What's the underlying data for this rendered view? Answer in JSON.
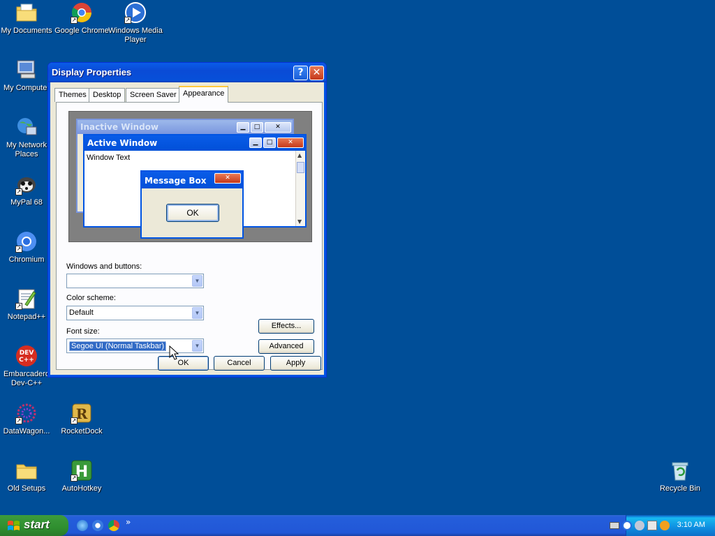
{
  "desktop": {
    "icons": [
      {
        "label": "My Documents",
        "icon": "folder-documents-icon"
      },
      {
        "label": "Google Chrome",
        "icon": "chrome-icon"
      },
      {
        "label": "Windows Media Player",
        "icon": "media-player-icon"
      },
      {
        "label": "My Computer",
        "icon": "computer-icon"
      },
      {
        "label": "My Network Places",
        "icon": "network-icon"
      },
      {
        "label": "MyPal 68",
        "icon": "raccoon-icon"
      },
      {
        "label": "Chromium",
        "icon": "chromium-icon"
      },
      {
        "label": "Notepad++",
        "icon": "notepadpp-icon"
      },
      {
        "label": "Embarcadero Dev-C++",
        "icon": "devcpp-icon"
      },
      {
        "label": "DataWagon...",
        "icon": "datawagon-icon"
      },
      {
        "label": "RocketDock",
        "icon": "rocketdock-icon"
      },
      {
        "label": "Old Setups",
        "icon": "folder-icon"
      },
      {
        "label": "AutoHotkey",
        "icon": "autohotkey-icon"
      },
      {
        "label": "Recycle Bin",
        "icon": "recycle-bin-icon"
      }
    ],
    "devcpp_badge": "DEV\nC++",
    "autohotkey_letter": "H",
    "rocketdock_letter": "R"
  },
  "dialog": {
    "title": "Display Properties",
    "help_glyph": "?",
    "close_glyph": "✕",
    "tabs": [
      {
        "label": "Themes"
      },
      {
        "label": "Desktop"
      },
      {
        "label": "Screen Saver"
      },
      {
        "label": "Appearance",
        "active": true
      }
    ],
    "preview": {
      "inactive_title": "Inactive Window",
      "active_title": "Active Window",
      "window_text": "Window Text",
      "message_title": "Message Box",
      "ok_label": "OK"
    },
    "windows_and_buttons": {
      "label": "Windows and buttons:",
      "value": ""
    },
    "color_scheme": {
      "label": "Color scheme:",
      "value": "Default"
    },
    "font_size": {
      "label": "Font size:",
      "value": "Segoe UI (Normal Taskbar)"
    },
    "effects_label": "Effects...",
    "advanced_label": "Advanced",
    "ok_label": "OK",
    "cancel_label": "Cancel",
    "apply_label": "Apply"
  },
  "taskbar": {
    "start_label": "start",
    "overflow_glyph": "»",
    "clock": "3:10 AM"
  },
  "colors": {
    "desktop": "#004e98",
    "titlebar": "#0a5ce8",
    "taskbar": "#245edb",
    "start": "#2f8f2f",
    "tray": "#0f8ee0"
  }
}
